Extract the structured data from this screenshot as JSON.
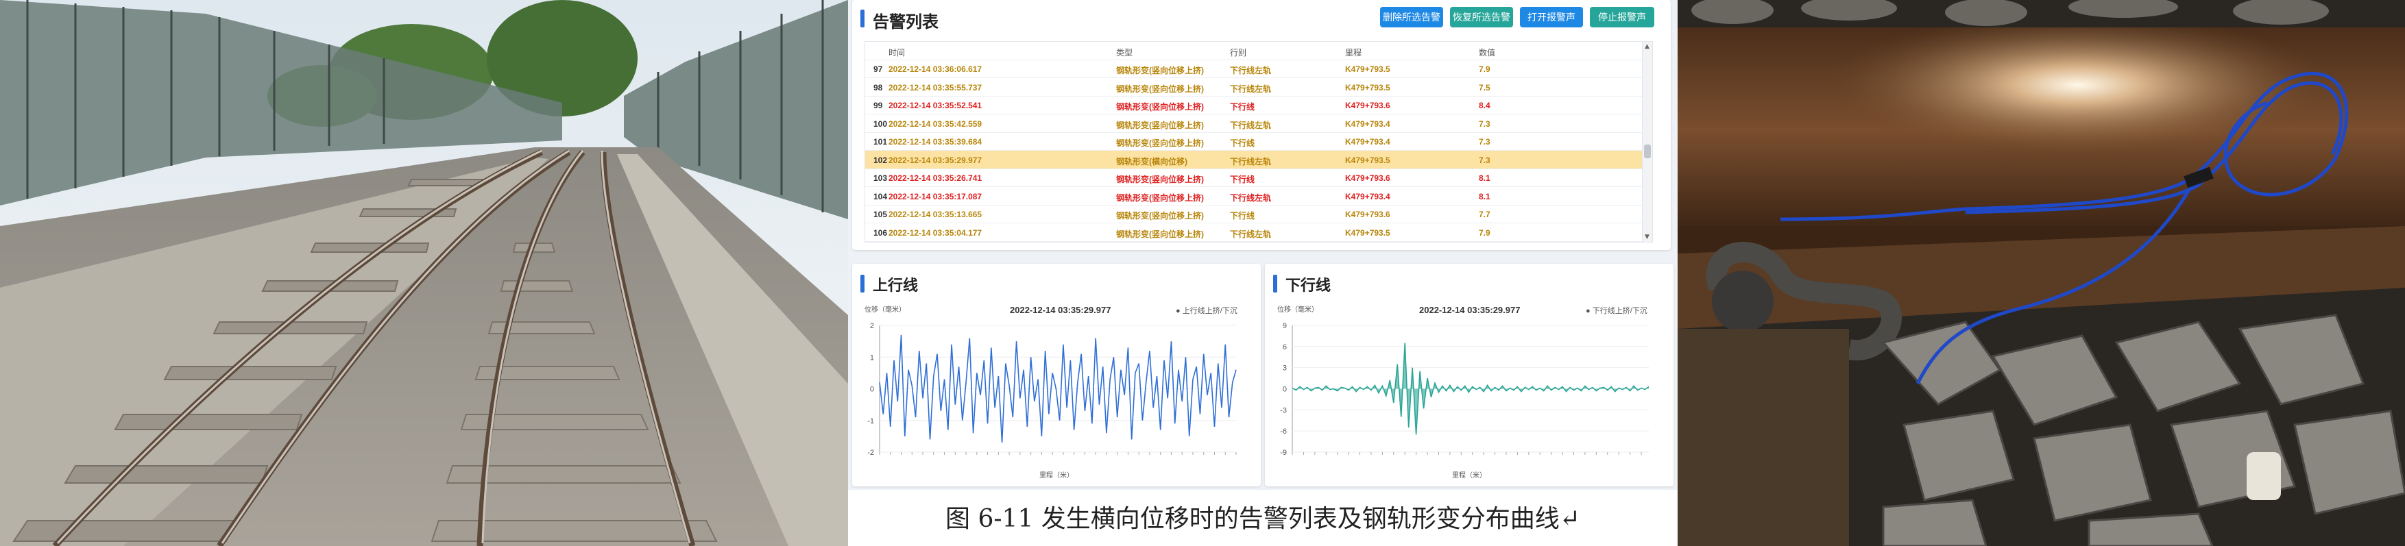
{
  "alarm_panel": {
    "title": "告警列表",
    "buttons": {
      "delete": "删除所选告警",
      "restore": "恢复所选告警",
      "open_sound": "打开报警声",
      "stop_sound": "停止报警声"
    },
    "columns": [
      "时间",
      "类型",
      "行别",
      "里程",
      "数值"
    ],
    "rows": [
      {
        "no": "97",
        "time": "2022-12-14 03:36:06.617",
        "type": "钢轨形变(竖向位移上挤)",
        "line": "下行线左轨",
        "mileage": "K479+793.5",
        "value": "7.9",
        "level": "warn"
      },
      {
        "no": "98",
        "time": "2022-12-14 03:35:55.737",
        "type": "钢轨形变(竖向位移上挤)",
        "line": "下行线左轨",
        "mileage": "K479+793.5",
        "value": "7.5",
        "level": "warn"
      },
      {
        "no": "99",
        "time": "2022-12-14 03:35:52.541",
        "type": "钢轨形变(竖向位移上挤)",
        "line": "下行线",
        "mileage": "K479+793.6",
        "value": "8.4",
        "level": "alarm"
      },
      {
        "no": "100",
        "time": "2022-12-14 03:35:42.559",
        "type": "钢轨形变(竖向位移上挤)",
        "line": "下行线左轨",
        "mileage": "K479+793.4",
        "value": "7.3",
        "level": "warn"
      },
      {
        "no": "101",
        "time": "2022-12-14 03:35:39.684",
        "type": "钢轨形变(竖向位移上挤)",
        "line": "下行线",
        "mileage": "K479+793.4",
        "value": "7.3",
        "level": "warn"
      },
      {
        "no": "102",
        "time": "2022-12-14 03:35:29.977",
        "type": "钢轨形变(横向位移)",
        "line": "下行线左轨",
        "mileage": "K479+793.5",
        "value": "7.3",
        "level": "selected"
      },
      {
        "no": "103",
        "time": "2022-12-14 03:35:26.741",
        "type": "钢轨形变(竖向位移上挤)",
        "line": "下行线",
        "mileage": "K479+793.6",
        "value": "8.1",
        "level": "alarm"
      },
      {
        "no": "104",
        "time": "2022-12-14 03:35:17.087",
        "type": "钢轨形变(竖向位移上挤)",
        "line": "下行线左轨",
        "mileage": "K479+793.4",
        "value": "8.1",
        "level": "alarm"
      },
      {
        "no": "105",
        "time": "2022-12-14 03:35:13.665",
        "type": "钢轨形变(竖向位移上挤)",
        "line": "下行线",
        "mileage": "K479+793.6",
        "value": "7.7",
        "level": "warn"
      },
      {
        "no": "106",
        "time": "2022-12-14 03:35:04.177",
        "type": "钢轨形变(竖向位移上挤)",
        "line": "下行线左轨",
        "mileage": "K479+793.5",
        "value": "7.9",
        "level": "warn"
      }
    ]
  },
  "colors": {
    "warn": "#b8860b",
    "alarm": "#e02020",
    "selected_bg": "#fde3a3",
    "up_series": "#2f6fd6",
    "down_series": "#2aa596",
    "accent": "#2b6fd6"
  },
  "chart_up": {
    "title": "上行线",
    "timestamp": "2022-12-14 03:35:29.977",
    "legend": "上行线上挤/下沉",
    "ylabel": "位移（毫米）",
    "xlabel": "里程（米）"
  },
  "chart_down": {
    "title": "下行线",
    "timestamp": "2022-12-14 03:35:29.977",
    "legend": "下行线上挤/下沉",
    "ylabel": "位移（毫米）",
    "xlabel": "里程（米）"
  },
  "chart_data": [
    {
      "type": "line",
      "title": "上行线",
      "ylabel": "位移（毫米）",
      "xlabel": "里程（米）",
      "ylim": [
        -2,
        2
      ],
      "yticks": [
        -2,
        -1,
        0,
        1,
        2
      ],
      "series": [
        {
          "name": "上行线上挤/下沉",
          "values": [
            0.2,
            -0.8,
            0.5,
            -1.2,
            0.9,
            -0.4,
            1.7,
            -1.5,
            0.6,
            0.1,
            -0.9,
            1.2,
            -0.3,
            0.8,
            -1.6,
            0.4,
            1.1,
            -0.7,
            0.3,
            -1.3,
            1.4,
            -0.5,
            0.7,
            -1.0,
            0.2,
            1.6,
            -1.4,
            0.5,
            -0.2,
            0.9,
            -1.1,
            1.3,
            -0.6,
            0.4,
            -1.7,
            0.8,
            0.1,
            -0.9,
            1.5,
            -0.3,
            0.6,
            -1.2,
            1.0,
            -0.4,
            0.3,
            -1.5,
            1.2,
            -0.8,
            0.5,
            0.0,
            -1.0,
            1.4,
            -0.6,
            0.9,
            -1.3,
            0.2,
            1.1,
            -0.7,
            0.4,
            -1.1,
            1.6,
            -0.5,
            0.7,
            -1.4,
            0.3,
            1.0,
            -0.9,
            0.6,
            -0.2,
            1.3,
            -1.6,
            0.5,
            0.8,
            -1.0,
            0.2,
            1.2,
            -0.6,
            0.4,
            -1.3,
            0.9,
            -0.3,
            1.5,
            -1.1,
            0.6,
            -0.4,
            1.0,
            -1.5,
            0.3,
            0.7,
            -0.8,
            1.1,
            -0.2,
            0.5,
            -1.2,
            0.8,
            -0.6,
            1.4,
            -0.9,
            0.2,
            0.6
          ]
        }
      ]
    },
    {
      "type": "line",
      "title": "下行线",
      "ylabel": "位移（毫米）",
      "xlabel": "里程（米）",
      "ylim": [
        -9,
        9
      ],
      "yticks": [
        -9,
        -6,
        -3,
        0,
        3,
        6,
        9
      ],
      "series": [
        {
          "name": "下行线上挤/下沉",
          "values": [
            0.1,
            -0.2,
            0.3,
            -0.1,
            0.2,
            -0.3,
            0.1,
            0.2,
            -0.2,
            0.4,
            -0.1,
            0.0,
            -0.3,
            0.2,
            0.1,
            -0.2,
            0.3,
            -0.4,
            0.2,
            -0.1,
            0.3,
            -0.2,
            0.5,
            -0.6,
            0.4,
            -1.0,
            1.2,
            -2.0,
            3.5,
            -4.0,
            6.5,
            -5.5,
            3.0,
            -6.5,
            2.5,
            -2.8,
            1.5,
            -1.2,
            0.8,
            -0.5,
            0.4,
            -0.3,
            0.5,
            -0.4,
            0.3,
            -0.2,
            0.4,
            -0.5,
            0.3,
            -0.1,
            0.2,
            -0.4,
            0.5,
            -0.3,
            0.2,
            -0.2,
            0.4,
            -0.3,
            0.1,
            -0.2,
            0.3,
            -0.4,
            0.2,
            -0.1,
            0.3,
            -0.2,
            0.1,
            -0.3,
            0.4,
            -0.2,
            0.2,
            -0.1,
            0.3,
            -0.4,
            0.2,
            -0.2,
            0.1,
            -0.3,
            0.4,
            -0.1,
            0.2,
            -0.3,
            0.1,
            0.2,
            -0.2,
            0.3,
            -0.4,
            0.1,
            -0.1,
            0.2,
            -0.3,
            0.4,
            -0.2,
            0.1,
            -0.1,
            0.3
          ]
        }
      ]
    }
  ],
  "caption": "图 6-11  发生横向位移时的告警列表及钢轨形变分布曲线↵"
}
